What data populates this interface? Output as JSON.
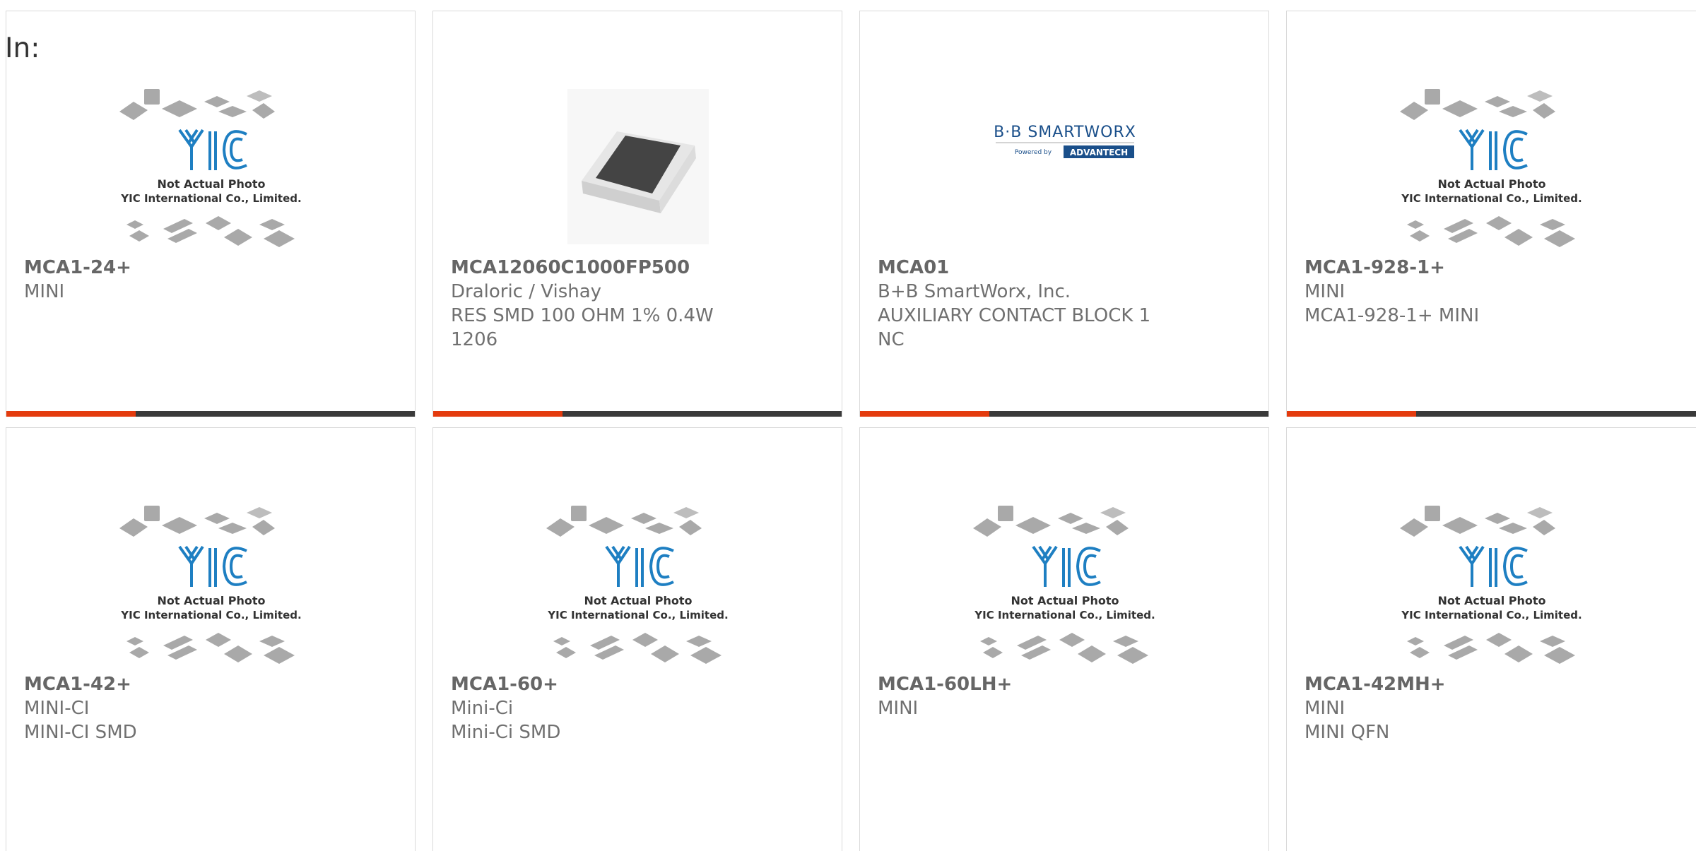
{
  "header": {
    "in_label": "In:"
  },
  "placeholder_text": {
    "line1": "Not Actual Photo",
    "line2": "YIC International Co., Limited.",
    "logo": "YIC"
  },
  "bb_logo": {
    "brand": "B·B SMARTWORX",
    "powered": "Powered by",
    "maker": "ADVANTECH"
  },
  "colors": {
    "accent": "#e43b0e",
    "bar": "#3a3a3a",
    "yic_blue": "#1e7fc2"
  },
  "products": [
    {
      "part": "MCA1-24+",
      "maker": "MINI",
      "desc": "",
      "image": "yic-placeholder"
    },
    {
      "part": "MCA12060C1000FP500",
      "maker": "Draloric / Vishay",
      "desc": "RES SMD 100 OHM 1% 0.4W 1206",
      "image": "smd-resistor"
    },
    {
      "part": "MCA01",
      "maker": "B+B SmartWorx, Inc.",
      "desc": "AUXILIARY CONTACT BLOCK 1 NC",
      "image": "bb-smartworx-logo"
    },
    {
      "part": "MCA1-928-1+",
      "maker": "MINI",
      "desc": "MCA1-928-1+ MINI",
      "image": "yic-placeholder"
    },
    {
      "part": "MCA1-42+",
      "maker": "MINI-CI",
      "desc": "MINI-CI SMD",
      "image": "yic-placeholder"
    },
    {
      "part": "MCA1-60+",
      "maker": "Mini-Ci",
      "desc": "Mini-Ci SMD",
      "image": "yic-placeholder"
    },
    {
      "part": "MCA1-60LH+",
      "maker": "MINI",
      "desc": "",
      "image": "yic-placeholder"
    },
    {
      "part": "MCA1-42MH+",
      "maker": "MINI",
      "desc": "MINI QFN",
      "image": "yic-placeholder"
    }
  ]
}
